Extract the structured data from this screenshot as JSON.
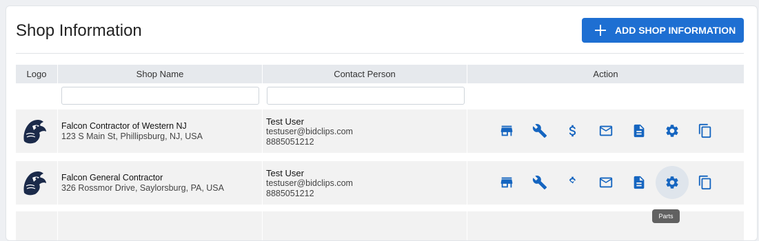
{
  "page": {
    "title": "Shop Information",
    "add_button_label": "ADD SHOP INFORMATION"
  },
  "table": {
    "headers": {
      "logo": "Logo",
      "shop_name": "Shop Name",
      "contact_person": "Contact Person",
      "action": "Action"
    },
    "filters": {
      "shop_name": "",
      "contact_person": ""
    },
    "rows": [
      {
        "shop_name": "Falcon Contractor of Western NJ",
        "address": "123 S Main St, Phillipsburg, NJ, USA",
        "contact_name": "Test User",
        "contact_email": "testuser@bidclips.com",
        "contact_phone": "8885051212"
      },
      {
        "shop_name": "Falcon General Contractor",
        "address": "326 Rossmor Drive, Saylorsburg, PA, USA",
        "contact_name": "Test User",
        "contact_email": "testuser@bidclips.com",
        "contact_phone": "8885051212"
      }
    ],
    "action_icons": [
      "store-icon",
      "wrench-icon",
      "dollar-icon",
      "mail-icon",
      "document-icon",
      "gear-icon",
      "copy-icon"
    ]
  },
  "tooltip": {
    "text": "Parts"
  },
  "colors": {
    "accent": "#1e6fd2",
    "icon": "#1565c0",
    "header_bg": "#e6e9ed",
    "row_bg": "#f2f2f2"
  }
}
